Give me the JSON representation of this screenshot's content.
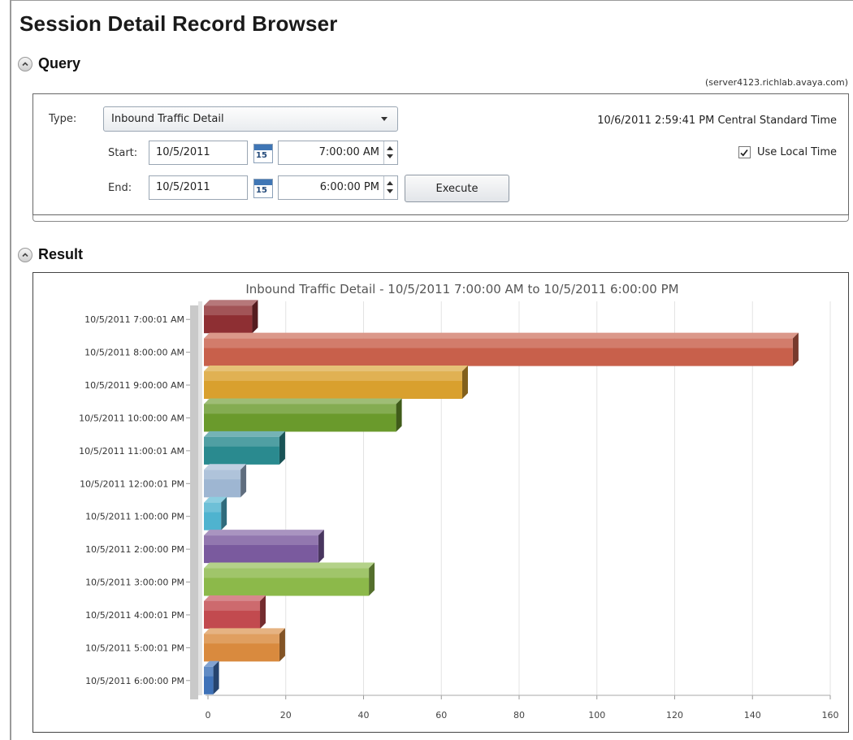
{
  "page": {
    "title": "Session Detail Record Browser"
  },
  "query": {
    "section_label": "Query",
    "server": "(server4123.richlab.avaya.com)",
    "type_label": "Type:",
    "type_value": "Inbound Traffic Detail",
    "datetime": "10/6/2011 2:59:41 PM Central Standard Time",
    "start_label": "Start:",
    "start_date": "10/5/2011",
    "start_time": "7:00:00 AM",
    "end_label": "End:",
    "end_date": "10/5/2011",
    "end_time": "6:00:00 PM",
    "calendar_day": "15",
    "execute_label": "Execute",
    "use_local_time_label": "Use Local Time",
    "use_local_time_checked": true
  },
  "result": {
    "section_label": "Result"
  },
  "chart_data": {
    "type": "bar",
    "orientation": "horizontal",
    "title": "Inbound Traffic Detail - 10/5/2011 7:00:00 AM to 10/5/2011 6:00:00 PM",
    "xlim": [
      0,
      160
    ],
    "xticks": [
      0,
      20,
      40,
      60,
      80,
      100,
      120,
      140,
      160
    ],
    "grid": true,
    "categories": [
      "10/5/2011 7:00:01 AM",
      "10/5/2011 8:00:00 AM",
      "10/5/2011 9:00:00 AM",
      "10/5/2011 10:00:00 AM",
      "10/5/2011 11:00:01 AM",
      "10/5/2011 12:00:01 PM",
      "10/5/2011 1:00:00 PM",
      "10/5/2011 2:00:00 PM",
      "10/5/2011 3:00:00 PM",
      "10/5/2011 4:00:01 PM",
      "10/5/2011 5:00:01 PM",
      "10/5/2011 6:00:00 PM"
    ],
    "values": [
      12,
      151,
      66,
      49,
      19,
      9,
      4,
      29,
      42,
      14,
      19,
      2
    ],
    "colors": [
      "#8e2f33",
      "#c8604b",
      "#d9a02e",
      "#6a9a2c",
      "#2a8a8f",
      "#9eb6d2",
      "#4fb3cf",
      "#7a5a9e",
      "#8cb94a",
      "#c24a4f",
      "#d98a3e",
      "#3f72b8"
    ]
  }
}
